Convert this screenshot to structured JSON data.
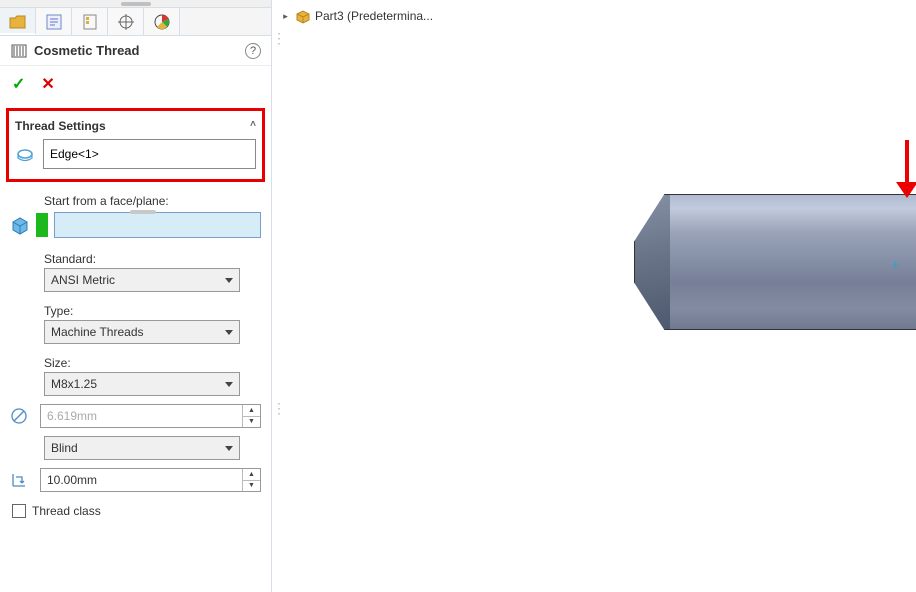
{
  "panel": {
    "title": "Cosmetic Thread",
    "confirm_glyph": "✓",
    "cancel_glyph": "✕",
    "help_glyph": "?"
  },
  "thread_settings": {
    "header": "Thread Settings",
    "collapse_glyph": "˄",
    "edge_value": "Edge<1>"
  },
  "start_from": {
    "label": "Start from a face/plane:",
    "value": ""
  },
  "standard": {
    "label": "Standard:",
    "value": "ANSI Metric"
  },
  "type": {
    "label": "Type:",
    "value": "Machine Threads"
  },
  "size": {
    "label": "Size:",
    "value": "M8x1.25"
  },
  "diameter": {
    "value": "6.619mm"
  },
  "end_condition": {
    "value": "Blind"
  },
  "depth": {
    "value": "10.00mm"
  },
  "thread_class": {
    "label": "Thread class"
  },
  "breadcrumb": {
    "collapse_glyph": "▸",
    "label": "Part3  (Predetermina..."
  }
}
